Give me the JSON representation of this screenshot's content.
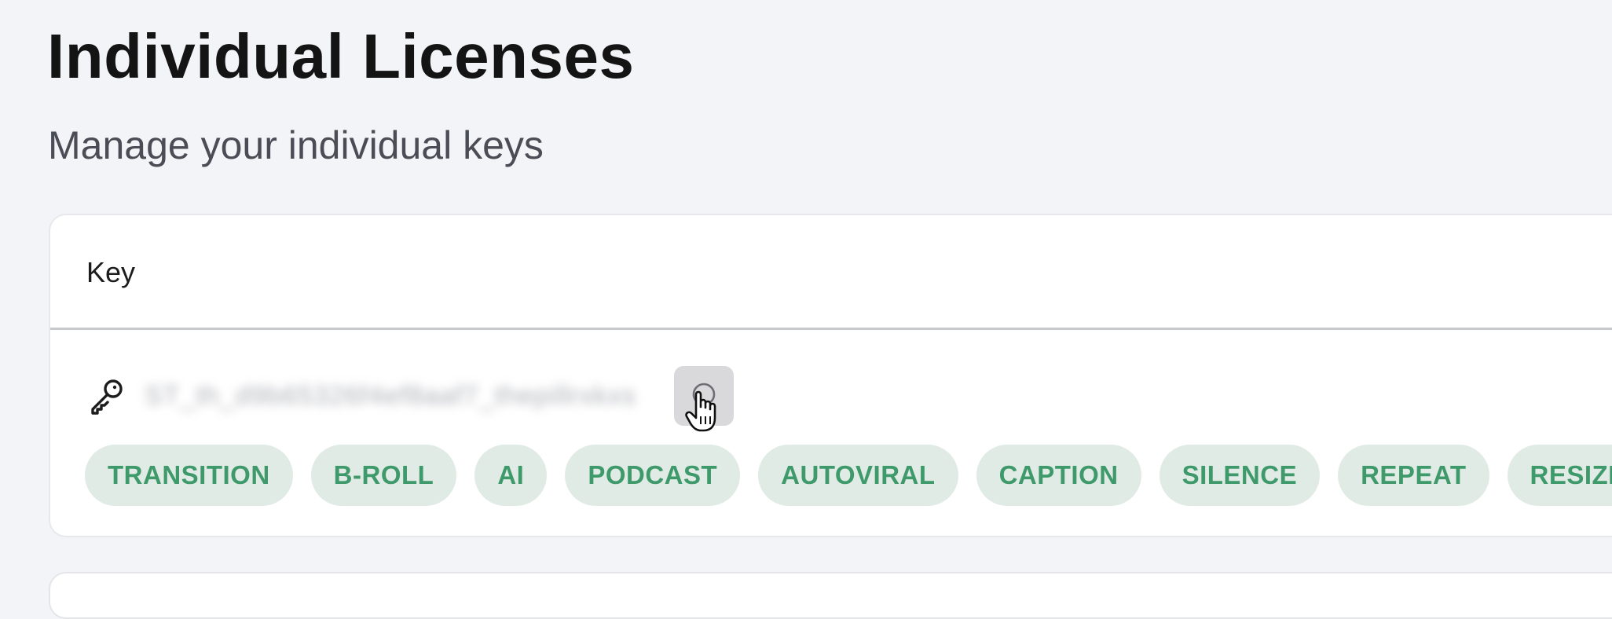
{
  "page": {
    "title": "Individual Licenses",
    "subtitle": "Manage your individual keys"
  },
  "licenses_table": {
    "columns": [
      "Key"
    ],
    "rows": [
      {
        "icon": "key-icon",
        "key_value": "ST_th_d9b65326f4ef8aaf7_thepillrxkxs",
        "copy_icon": "copy-icon",
        "tags": [
          "TRANSITION",
          "B-ROLL",
          "AI",
          "PODCAST",
          "AUTOVIRAL",
          "CAPTION",
          "SILENCE",
          "REPEAT",
          "RESIZE"
        ]
      }
    ]
  },
  "colors": {
    "background": "#f3f4f8",
    "card": "#ffffff",
    "tag_background": "#e1ebe5",
    "tag_text": "#3f9a6b"
  }
}
